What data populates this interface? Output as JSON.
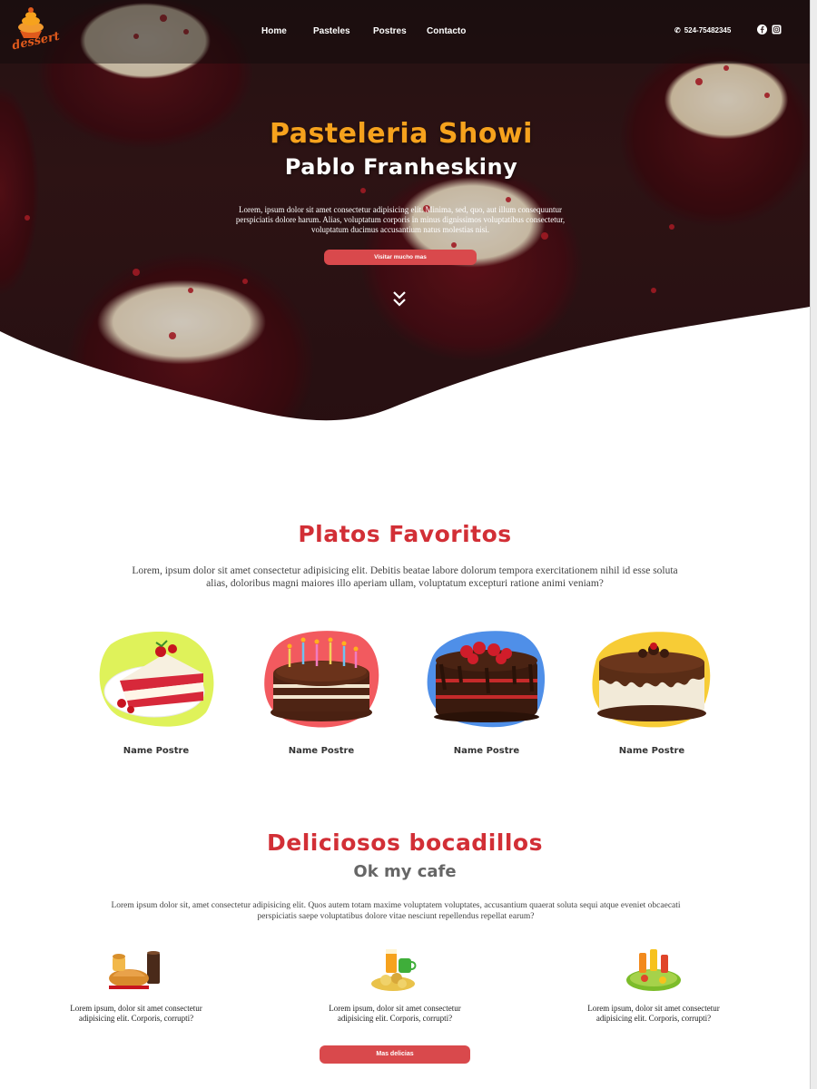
{
  "nav": {
    "links": [
      "Home",
      "Pasteles",
      "Postres",
      "Contacto"
    ],
    "phone": "524-75482345",
    "logo_text": "dessert"
  },
  "hero": {
    "title": "Pasteleria Showi",
    "subtitle": "Pablo Franheskiny",
    "text": "Lorem, ipsum dolor sit amet consectetur adipisicing elit. Minima, sed, quo, aut illum consequuntur perspiciatis dolore harum. Alias, voluptatum corporis in minus dignissimos voluptatibus consectetur, voluptatum ducimus accusantium natus molestias nisi.",
    "button": "Visitar mucho mas"
  },
  "favorites": {
    "title": "Platos Favoritos",
    "text": "Lorem, ipsum dolor sit amet consectetur adipisicing elit. Debitis beatae labore dolorum tempora exercitationem nihil id esse soluta alias, doloribus magni maiores illo aperiam ullam, voluptatum excepturi ratione animi veniam?",
    "items": [
      {
        "name": "Name Postre",
        "blob_color": "#dff25a"
      },
      {
        "name": "Name Postre",
        "blob_color": "#f25a5f"
      },
      {
        "name": "Name Postre",
        "blob_color": "#4f8fe8"
      },
      {
        "name": "Name Postre",
        "blob_color": "#f7cc36"
      }
    ]
  },
  "snacks": {
    "title": "Deliciosos bocadillos",
    "subtitle": "Ok my cafe",
    "text": "Lorem ipsum dolor sit, amet consectetur adipisicing elit. Quos autem totam maxime voluptatem voluptates, accusantium quaerat soluta sequi atque eveniet obcaecati perspiciatis saepe voluptatibus dolore vitae nesciunt repellendus repellat earum?",
    "items": [
      {
        "text": "Lorem ipsum, dolor sit amet consectetur adipisicing elit. Corporis, corrupti?"
      },
      {
        "text": "Lorem ipsum, dolor sit amet consectetur adipisicing elit. Corporis, corrupti?"
      },
      {
        "text": "Lorem ipsum, dolor sit amet consectetur adipisicing elit. Corporis, corrupti?"
      }
    ],
    "button": "Mas delicias"
  },
  "colors": {
    "accent": "#d9494c",
    "title_red": "#d22f36",
    "hero_title": "#f6a21d"
  }
}
